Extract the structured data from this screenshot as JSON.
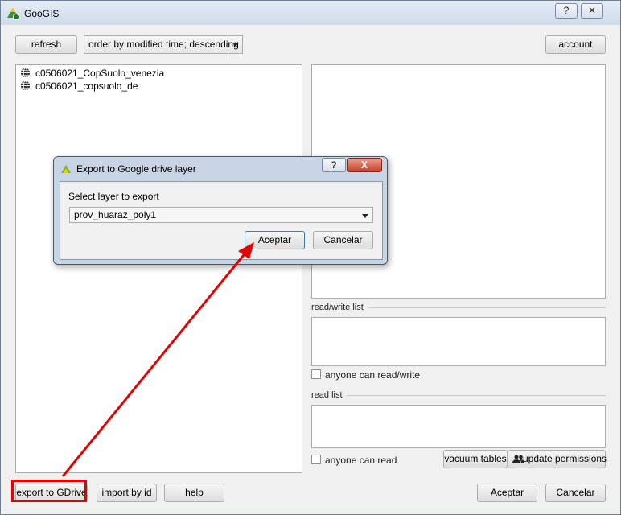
{
  "window": {
    "title": "GooGIS",
    "help_label": "?",
    "close_label": "✕"
  },
  "toolbar": {
    "refresh_label": "refresh",
    "order_value": "order by modified time; descending",
    "account_label": "account"
  },
  "layers": [
    {
      "name": "c0506021_CopSuolo_venezia"
    },
    {
      "name": "c0506021_copsuolo_de"
    }
  ],
  "permissions": {
    "read_write_label": "read/write list",
    "anyone_read_write_label": "anyone can read/write",
    "read_label": "read list",
    "anyone_read_label": "anyone can read",
    "vacuum_label": "vacuum tables",
    "update_permissions_label": "update permissions"
  },
  "footer": {
    "export_label": "export to GDrive",
    "import_label": "import by id",
    "help_label": "help",
    "accept_label": "Aceptar",
    "cancel_label": "Cancelar"
  },
  "dialog": {
    "title": "Export to Google drive layer",
    "help_label": "?",
    "close_label": "X",
    "select_label": "Select layer to export",
    "layer_value": "prov_huaraz_poly1",
    "accept_label": "Aceptar",
    "cancel_label": "Cancelar"
  },
  "annotation": {
    "color": "#e20000"
  }
}
